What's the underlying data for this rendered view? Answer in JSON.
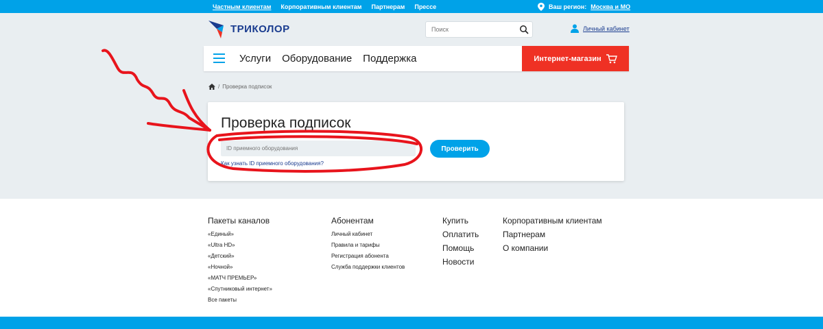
{
  "topbar": {
    "nav": [
      "Частным клиентам",
      "Корпоративным клиентам",
      "Партнерам",
      "Прессе"
    ],
    "region_label": "Ваш регион:",
    "region_value": "Москва и МО"
  },
  "header": {
    "logo_text": "ТРИКОЛОР",
    "search_placeholder": "Поиск",
    "cabinet_label": "Личный кабинет"
  },
  "mainnav": {
    "items": [
      "Услуги",
      "Оборудование",
      "Поддержка"
    ],
    "shop_label": "Интернет-магазин"
  },
  "breadcrumb": {
    "separator": "/",
    "current": "Проверка подписок"
  },
  "card": {
    "title": "Проверка подписок",
    "input_placeholder": "ID приемного оборудования",
    "button_label": "Проверить",
    "help_link": "Как узнать ID приемного оборудования?"
  },
  "footer": {
    "col1": {
      "head": "Пакеты каналов",
      "items": [
        "«Единый»",
        "«Ultra HD»",
        "«Детский»",
        "«Ночной»",
        "«МАТЧ ПРЕМЬЕР»",
        "«Спутниковый интернет»",
        "Все пакеты"
      ]
    },
    "col2": {
      "head": "Абонентам",
      "items": [
        "Личный кабинет",
        "Правила и тарифы",
        "Регистрация абонента",
        "Служба поддержки клиентов"
      ]
    },
    "col3": {
      "items": [
        "Купить",
        "Оплатить",
        "Помощь",
        "Новости"
      ]
    },
    "col4": {
      "items": [
        "Корпоративным клиентам",
        "Партнерам",
        "О компании"
      ]
    }
  },
  "colors": {
    "accent": "#00a2e8",
    "brand": "#1a3c8f",
    "shop": "#ef3124",
    "annotation": "#e8141c"
  }
}
